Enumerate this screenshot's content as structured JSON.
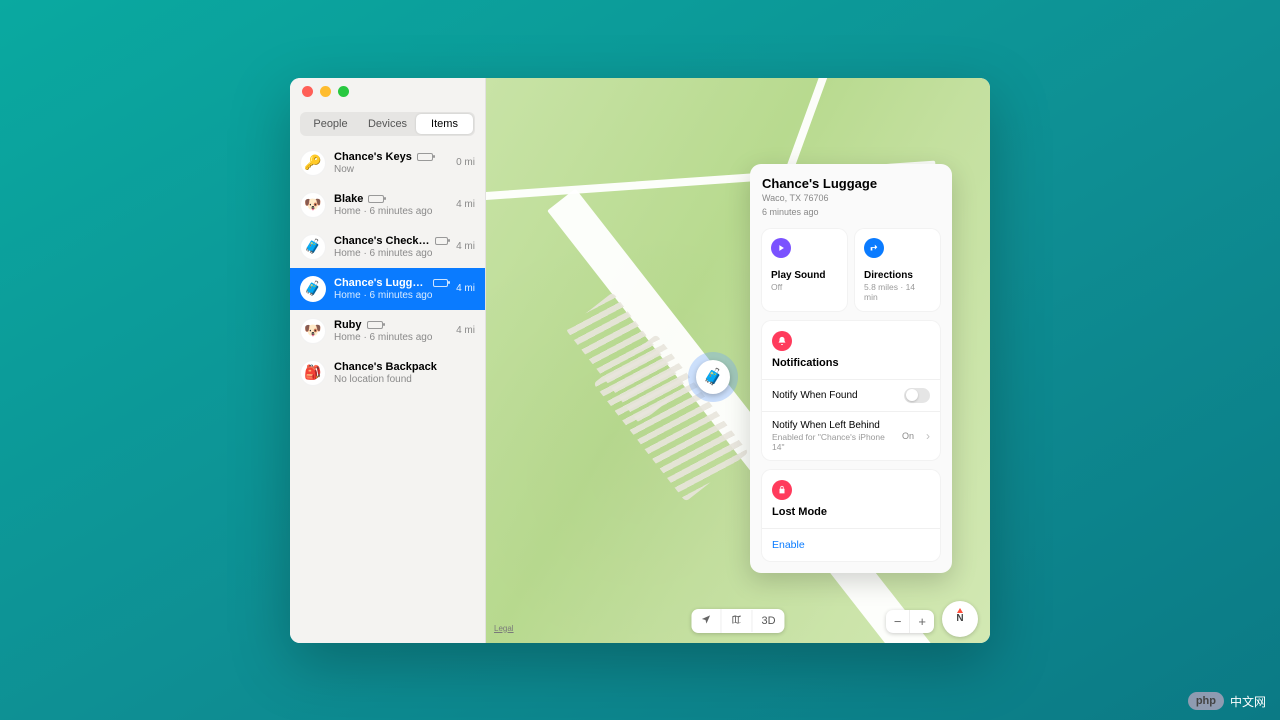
{
  "tabs": {
    "people": "People",
    "devices": "Devices",
    "items": "Items",
    "selected": "items"
  },
  "items": [
    {
      "icon": "🔑",
      "name": "Chance's Keys",
      "sub": "Now",
      "dist": "0 mi",
      "battery": true
    },
    {
      "icon": "🐶",
      "name": "Blake",
      "sub": "Home · 6 minutes ago",
      "dist": "4 mi",
      "battery": true
    },
    {
      "icon": "🧳",
      "name": "Chance's Checked L...",
      "sub": "Home · 6 minutes ago",
      "dist": "4 mi",
      "battery": true
    },
    {
      "icon": "🧳",
      "name": "Chance's Luggage",
      "sub": "Home · 6 minutes ago",
      "dist": "4 mi",
      "battery": true,
      "selected": true
    },
    {
      "icon": "🐶",
      "name": "Ruby",
      "sub": "Home · 6 minutes ago",
      "dist": "4 mi",
      "battery": true
    },
    {
      "icon": "🎒",
      "name": "Chance's Backpack",
      "sub": "No location found",
      "dist": "",
      "battery": false
    }
  ],
  "detail": {
    "title": "Chance's Luggage",
    "addr": "Waco, TX  76706",
    "time": "6 minutes ago",
    "tiles": {
      "play": {
        "label": "Play Sound",
        "sub": "Off"
      },
      "dir": {
        "label": "Directions",
        "sub": "5.8 miles · 14 min"
      }
    },
    "notifications": {
      "title": "Notifications",
      "nwf": "Notify When Found",
      "nwlb": "Notify When Left Behind",
      "nwlb_state": "On",
      "nwlb_sub": "Enabled for \"Chance's iPhone 14\""
    },
    "lost": {
      "title": "Lost Mode",
      "enable": "Enable"
    }
  },
  "map": {
    "legal": "Legal",
    "threeD": "3D",
    "compass": "N",
    "zoom_out": "−",
    "zoom_in": "+"
  },
  "badge": {
    "label": "中文网"
  }
}
